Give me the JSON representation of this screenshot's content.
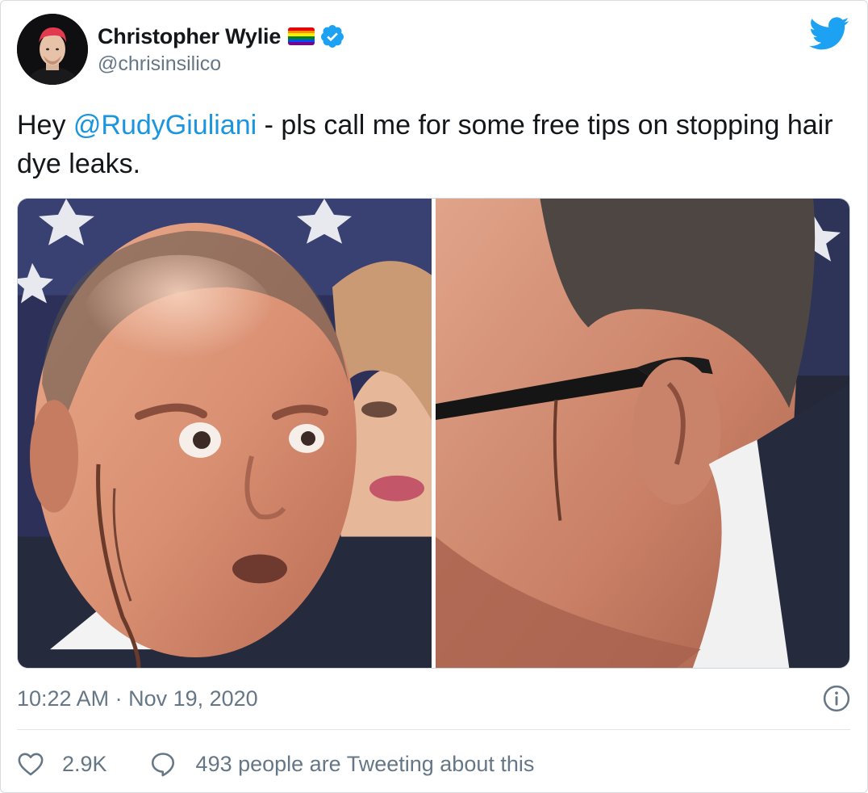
{
  "author": {
    "display_name": "Christopher Wylie",
    "handle": "@chrisinsilico",
    "verified": true,
    "flag_colors": [
      "#e40303",
      "#ff8c00",
      "#ffed00",
      "#008026",
      "#004dff",
      "#750787"
    ]
  },
  "tweet": {
    "text_prefix": "Hey ",
    "mention": "@RudyGiuliani",
    "text_suffix": " - pls call me for some free tips on stopping hair dye leaks.",
    "timestamp": "10:22 AM · Nov 19, 2020"
  },
  "media": {
    "photo_count": 2
  },
  "stats": {
    "likes": "2.9K",
    "conversation": "493 people are Tweeting about this"
  },
  "icons": {
    "brand": "twitter-bird-icon",
    "verified": "verified-badge-icon",
    "info": "info-icon",
    "like": "heart-icon",
    "reply": "speech-bubble-icon"
  },
  "colors": {
    "brand_blue": "#1da1f2",
    "link_blue": "#1b95e0",
    "secondary_text": "#657786",
    "primary_text": "#14171a"
  }
}
